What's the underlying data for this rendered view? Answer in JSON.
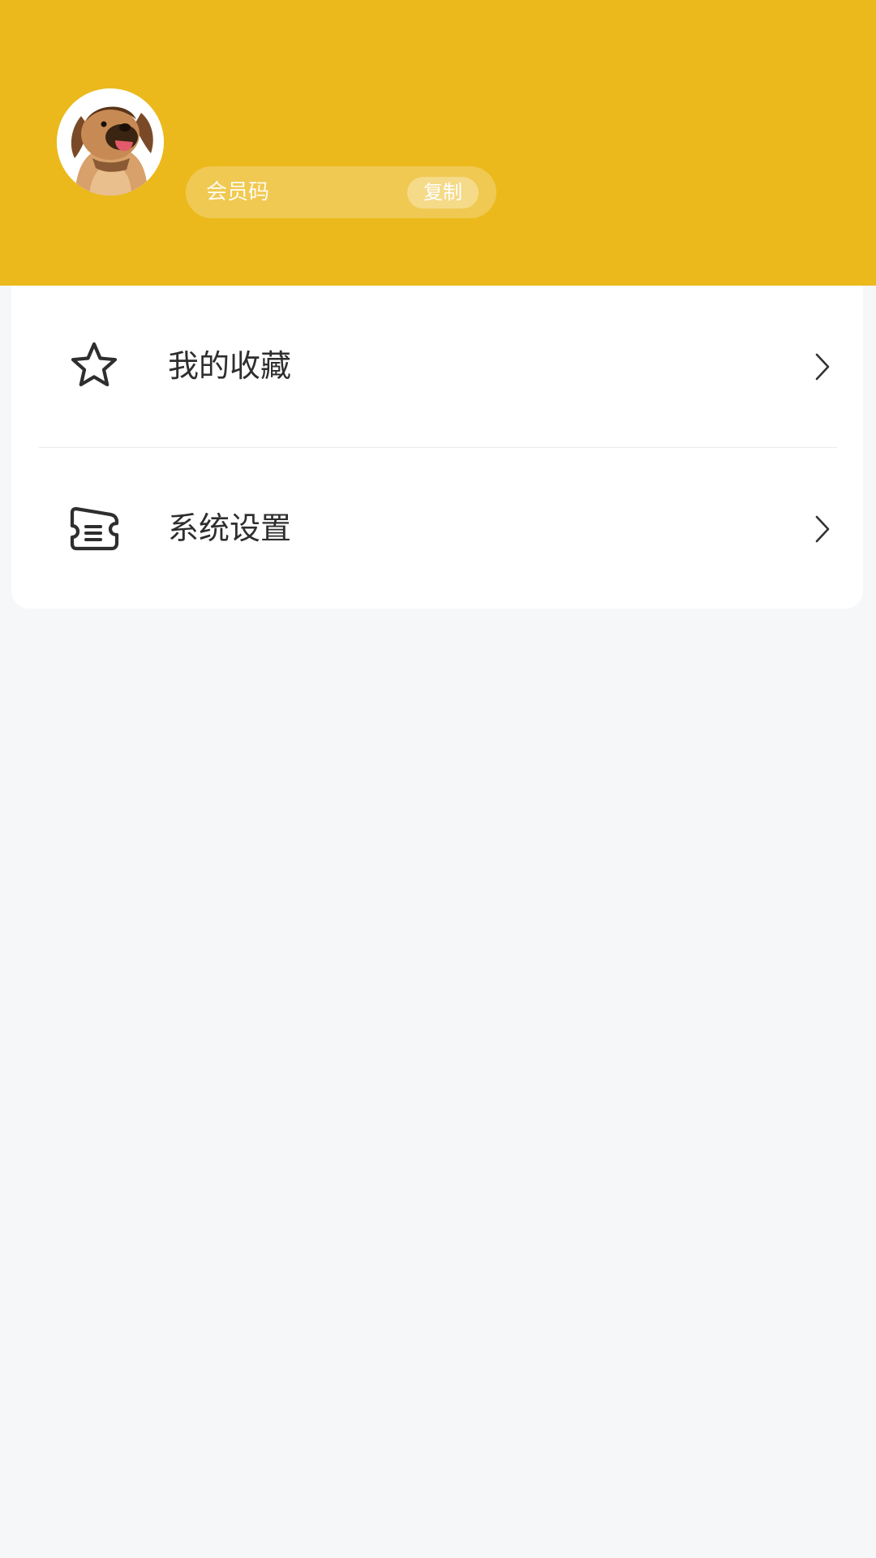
{
  "profile": {
    "member_code_label": "会员码",
    "copy_label": "复制"
  },
  "menu": {
    "items": [
      {
        "label": "我的收藏",
        "icon": "star-icon"
      },
      {
        "label": "系统设置",
        "icon": "ticket-icon"
      }
    ]
  },
  "colors": {
    "header_background": "#ebb91c",
    "page_background": "#f6f7f9",
    "card_background": "#ffffff",
    "text_primary": "#2e2e2e"
  }
}
